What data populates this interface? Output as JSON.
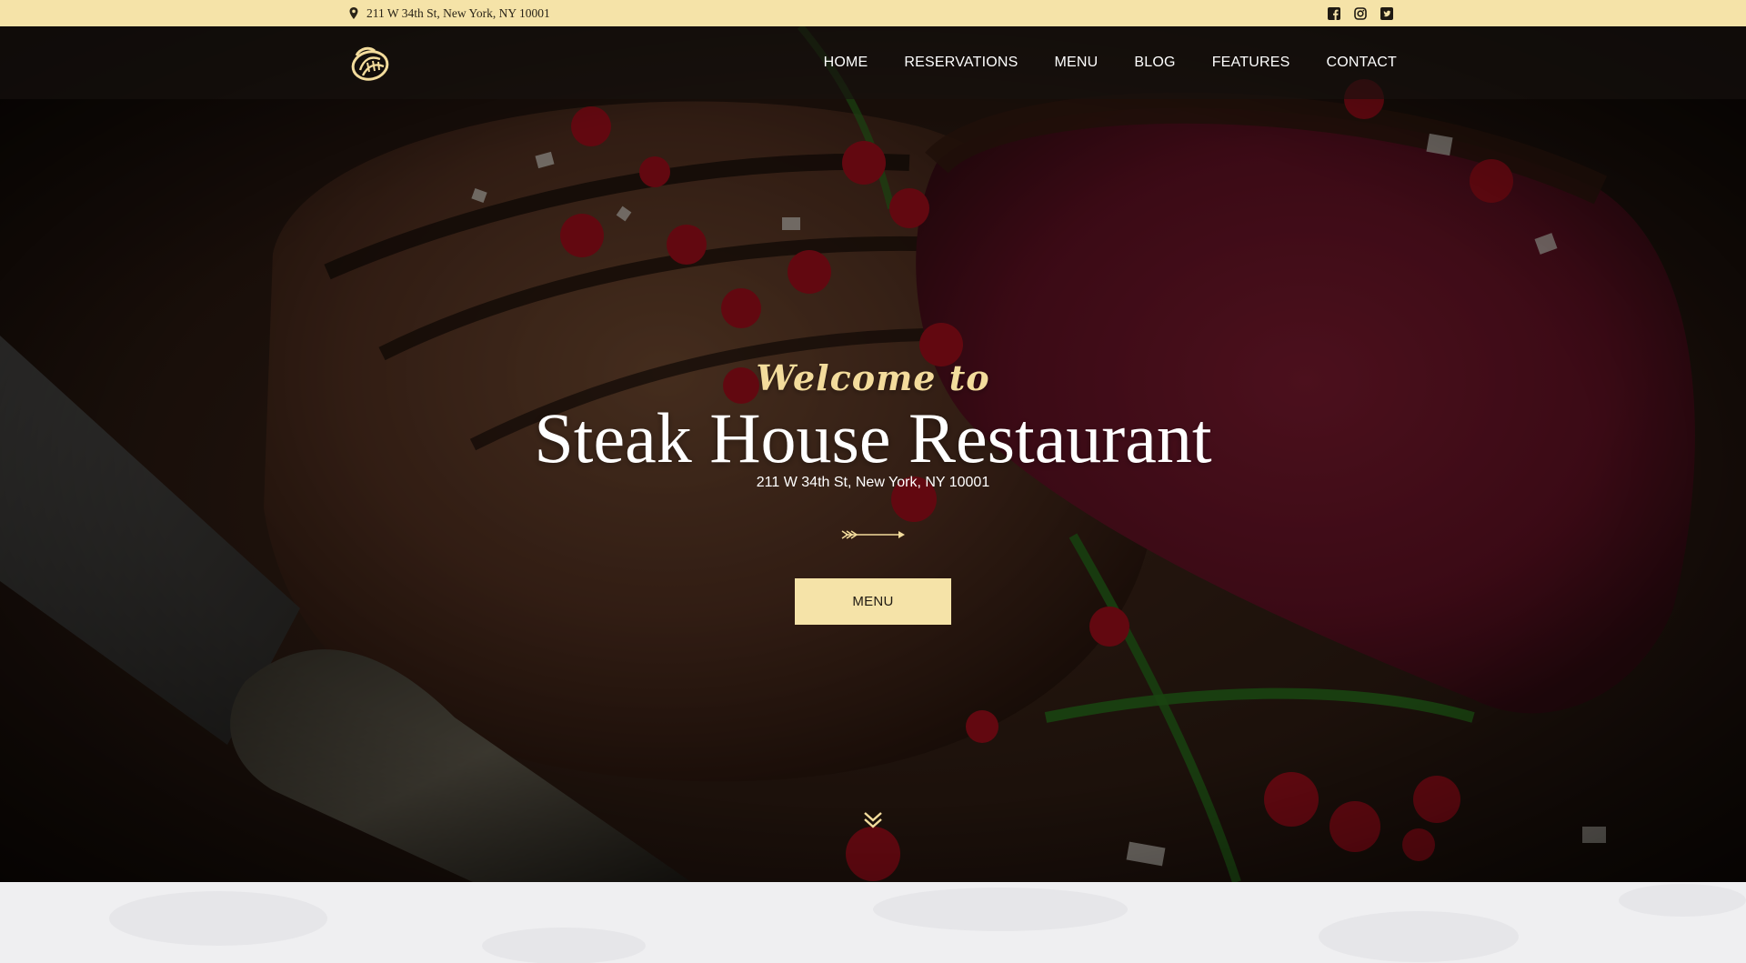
{
  "topbar": {
    "address": "211 W 34th St, New York, NY 10001",
    "icons": {
      "location": "map-pin-icon",
      "social": [
        "facebook-icon",
        "instagram-icon",
        "twitter-icon"
      ]
    },
    "background": "#f5e3a8"
  },
  "nav": {
    "logo": "steakhouse-logo",
    "items": [
      {
        "label": "HOME"
      },
      {
        "label": "RESERVATIONS"
      },
      {
        "label": "MENU"
      },
      {
        "label": "BLOG"
      },
      {
        "label": "FEATURES"
      },
      {
        "label": "CONTACT"
      }
    ]
  },
  "hero": {
    "welcome": "Welcome to",
    "title": "Steak House Restaurant",
    "address": "211 W 34th St, New York, NY 10001",
    "button_label": "MENU",
    "accent": "#f3dc9c",
    "divider_icon": "arrow-divider-icon",
    "scroll_icon": "double-chevron-down-icon"
  }
}
